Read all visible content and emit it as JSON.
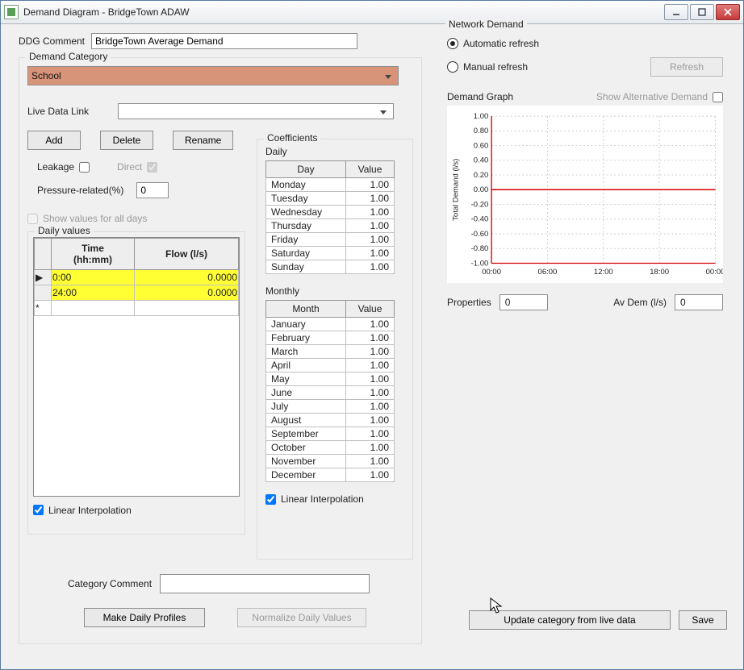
{
  "window": {
    "title": "Demand Diagram - BridgeTown ADAW"
  },
  "ddg_comment": {
    "label": "DDG Comment",
    "value": "BridgeTown Average Demand"
  },
  "demand_category": {
    "legend": "Demand Category",
    "selected": "School",
    "live_data_link_label": "Live Data Link",
    "live_data_link_value": "",
    "buttons": {
      "add": "Add",
      "delete": "Delete",
      "rename": "Rename"
    },
    "leakage_label": "Leakage",
    "direct_label": "Direct",
    "leakage_checked": false,
    "direct_checked": true,
    "pressure_label": "Pressure-related(%)",
    "pressure_value": "0",
    "show_all_days_label": "Show values for all days",
    "show_all_days_checked": false,
    "daily_values": {
      "legend": "Daily values",
      "headers": {
        "time": "Time\n(hh:mm)",
        "flow": "Flow (l/s)"
      },
      "rows": [
        {
          "time": "0:00",
          "flow": "0.0000"
        },
        {
          "time": "24:00",
          "flow": "0.0000"
        }
      ],
      "linear_interp_label": "Linear Interpolation",
      "linear_interp_checked": true
    },
    "category_comment_label": "Category Comment",
    "category_comment_value": "",
    "make_profiles_btn": "Make Daily Profiles",
    "normalize_btn": "Normalize Daily Values"
  },
  "coefficients": {
    "legend": "Coefficients",
    "daily_label": "Daily",
    "daily_headers": {
      "day": "Day",
      "value": "Value"
    },
    "daily_rows": [
      {
        "day": "Monday",
        "value": "1.00"
      },
      {
        "day": "Tuesday",
        "value": "1.00"
      },
      {
        "day": "Wednesday",
        "value": "1.00"
      },
      {
        "day": "Thursday",
        "value": "1.00"
      },
      {
        "day": "Friday",
        "value": "1.00"
      },
      {
        "day": "Saturday",
        "value": "1.00"
      },
      {
        "day": "Sunday",
        "value": "1.00"
      }
    ],
    "monthly_label": "Monthly",
    "monthly_headers": {
      "month": "Month",
      "value": "Value"
    },
    "monthly_rows": [
      {
        "month": "January",
        "value": "1.00"
      },
      {
        "month": "February",
        "value": "1.00"
      },
      {
        "month": "March",
        "value": "1.00"
      },
      {
        "month": "April",
        "value": "1.00"
      },
      {
        "month": "May",
        "value": "1.00"
      },
      {
        "month": "June",
        "value": "1.00"
      },
      {
        "month": "July",
        "value": "1.00"
      },
      {
        "month": "August",
        "value": "1.00"
      },
      {
        "month": "September",
        "value": "1.00"
      },
      {
        "month": "October",
        "value": "1.00"
      },
      {
        "month": "November",
        "value": "1.00"
      },
      {
        "month": "December",
        "value": "1.00"
      }
    ],
    "linear_interp_label": "Linear Interpolation",
    "linear_interp_checked": true
  },
  "network_demand": {
    "legend": "Network Demand",
    "auto_label": "Automatic refresh",
    "manual_label": "Manual refresh",
    "selected": "auto",
    "refresh_btn": "Refresh",
    "graph_label": "Demand Graph",
    "show_alt_label": "Show Alternative Demand",
    "show_alt_checked": false,
    "properties_label": "Properties",
    "properties_value": "0",
    "avdem_label": "Av Dem (l/s)",
    "avdem_value": "0"
  },
  "footer": {
    "update_btn": "Update category from live data",
    "save_btn": "Save"
  },
  "chart_data": {
    "type": "line",
    "title": "",
    "xlabel": "",
    "ylabel": "Total Demand (l/s)",
    "x_ticks": [
      "00:00",
      "06:00",
      "12:00",
      "18:00",
      "00:00"
    ],
    "y_ticks": [
      1.0,
      0.8,
      0.6,
      0.4,
      0.2,
      0.0,
      -0.2,
      -0.4,
      -0.6,
      -0.8,
      -1.0
    ],
    "ylim": [
      -1.0,
      1.0
    ],
    "series": [
      {
        "name": "Total Demand",
        "color": "#d40000",
        "x": [
          "00:00",
          "24:00"
        ],
        "y": [
          0.0,
          0.0
        ]
      }
    ]
  }
}
